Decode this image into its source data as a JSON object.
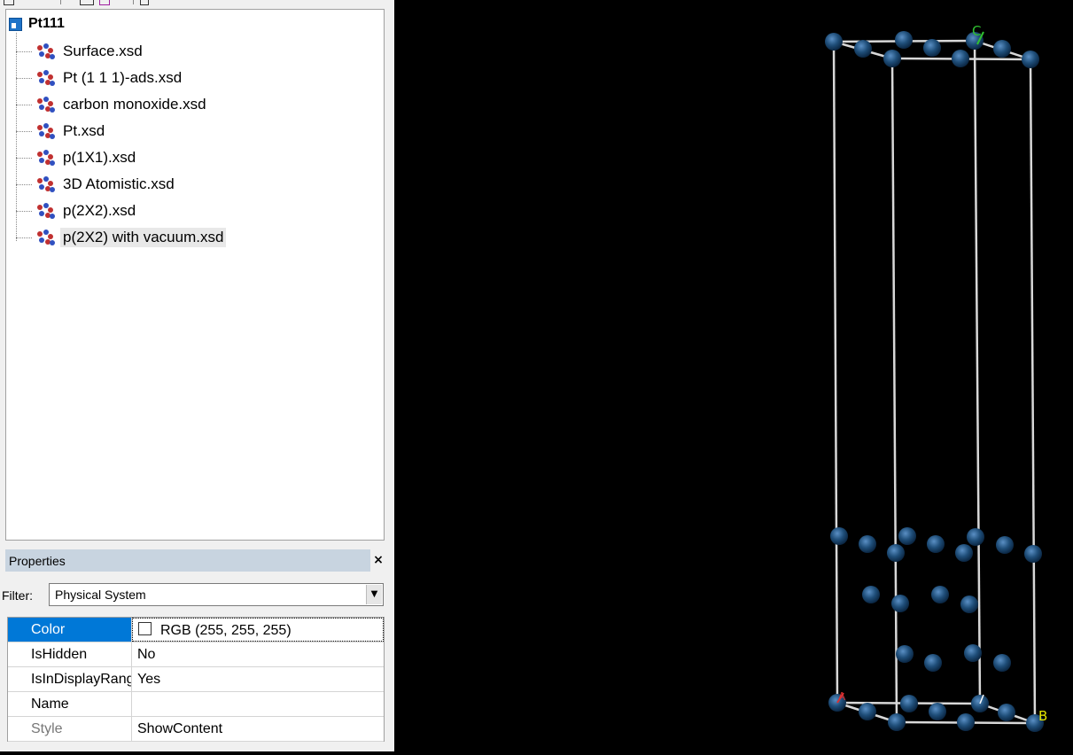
{
  "project_tree": {
    "root": {
      "label": "Pt111",
      "icon": "project-icon"
    },
    "items": [
      {
        "label": "Surface.xsd",
        "icon": "molecule-icon"
      },
      {
        "label": "Pt (1 1 1)-ads.xsd",
        "icon": "molecule-icon"
      },
      {
        "label": "carbon monoxide.xsd",
        "icon": "molecule-icon"
      },
      {
        "label": "Pt.xsd",
        "icon": "molecule-icon"
      },
      {
        "label": "p(1X1).xsd",
        "icon": "molecule-icon"
      },
      {
        "label": "3D Atomistic.xsd",
        "icon": "molecule-icon"
      },
      {
        "label": "p(2X2).xsd",
        "icon": "molecule-icon"
      },
      {
        "label": "p(2X2) with vacuum.xsd",
        "icon": "molecule-icon",
        "selected": true
      }
    ]
  },
  "properties": {
    "title": "Properties",
    "close_label": "×",
    "filter_label": "Filter:",
    "filter_value": "Physical System",
    "rows": [
      {
        "name": "Color",
        "value": "RGB (255, 255, 255)",
        "swatch": "#ffffff",
        "selected": true
      },
      {
        "name": "IsHidden",
        "value": "No"
      },
      {
        "name": "IsInDisplayRange",
        "value": "Yes"
      },
      {
        "name": "Name",
        "value": ""
      },
      {
        "name": "Style",
        "value": "ShowContent",
        "disabled": true
      }
    ]
  },
  "viewer": {
    "axis_labels": {
      "a": "A",
      "b": "B",
      "c": "C"
    },
    "colors": {
      "background": "#000000",
      "atom": "#1f4e79",
      "cell_edge": "#d8d8d8",
      "axis_a": "#e03030",
      "axis_b": "#e6e600",
      "axis_c": "#30c030"
    }
  }
}
